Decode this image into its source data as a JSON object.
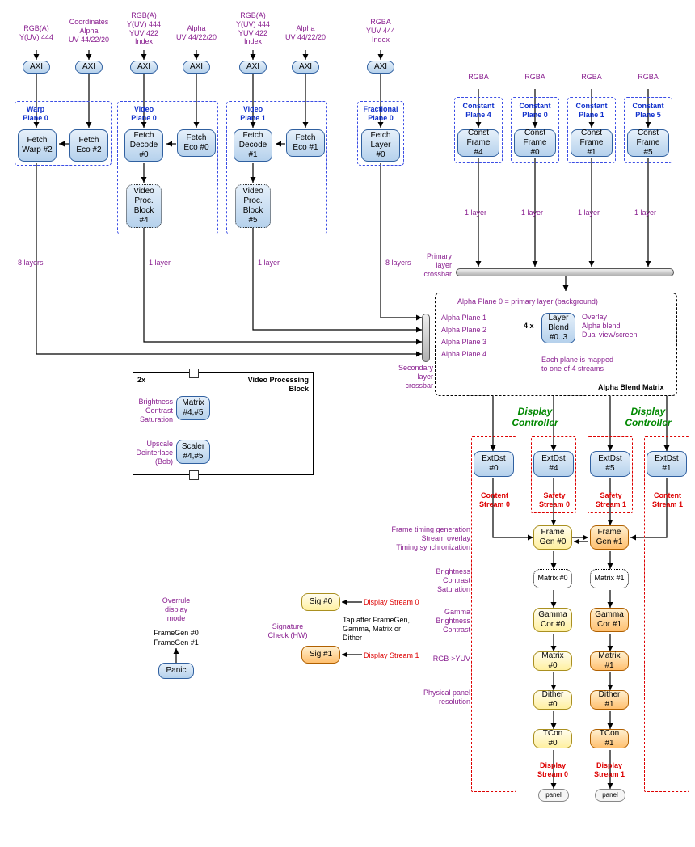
{
  "headers": {
    "col1": "RGB(A)\nY(UV) 444",
    "col2": "Coordinates\nAlpha\nUV 44/22/20",
    "col3": "RGB(A)\nY(UV) 444\nYUV 422\nIndex",
    "col4": "Alpha\nUV 44/22/20",
    "col5": "RGB(A)\nY(UV) 444\nYUV 422\nIndex",
    "col6": "Alpha\nUV 44/22/20",
    "col7": "RGBA\nYUV 444\nIndex",
    "c0": "RGBA",
    "c1": "RGBA",
    "c2": "RGBA",
    "c3": "RGBA"
  },
  "axi": "AXI",
  "planes": {
    "warp0": "Warp\nPlane 0",
    "video0": "Video\nPlane 0",
    "video1": "Video\nPlane 1",
    "frac0": "Fractional\nPlane 0",
    "const4": "Constant\nPlane 4",
    "const0": "Constant\nPlane 0",
    "const1": "Constant\nPlane 1",
    "const5": "Constant\nPlane 5"
  },
  "blocks": {
    "fetchWarp2": "Fetch\nWarp #2",
    "fetchEco2": "Fetch\nEco #2",
    "fetchDec0": "Fetch\nDecode\n#0",
    "fetchEco0": "Fetch\nEco #0",
    "fetchDec1": "Fetch\nDecode\n#1",
    "fetchEco1": "Fetch\nEco #1",
    "fetchLayer0": "Fetch\nLayer #0",
    "vpb4": "Video\nProc.\nBlock\n#4",
    "vpb5": "Video\nProc.\nBlock\n#5",
    "constF4": "Const\nFrame #4",
    "constF0": "Const\nFrame #0",
    "constF1": "Const\nFrame #1",
    "constF5": "Const\nFrame #5",
    "matrix45": "Matrix\n#4,#5",
    "scaler45": "Scaler\n#4,#5",
    "layerBlend": "Layer\nBlend\n#0..3",
    "extDst0": "ExtDst\n#0",
    "extDst4": "ExtDst\n#4",
    "extDst5": "ExtDst\n#5",
    "extDst1": "ExtDst\n#1",
    "frameGen0": "Frame\nGen #0",
    "frameGen1": "Frame\nGen #1",
    "matrix0": "Matrix #0",
    "matrix1": "Matrix #1",
    "gamma0": "Gamma\nCor #0",
    "gamma1": "Gamma\nCor #1",
    "matrix0b": "Matrix #0",
    "matrix1b": "Matrix #1",
    "dither0": "Dither #0",
    "dither1": "Dither #1",
    "tcon0": "TCon #0",
    "tcon1": "TCon #1",
    "panel": "panel",
    "sig0": "Sig #0",
    "sig1": "Sig #1",
    "panic": "Panic"
  },
  "labels": {
    "eightLayers": "8 layers",
    "oneLayer": "1 layer",
    "primaryCrossbar": "Primary\nlayer\ncrossbar",
    "secondaryCrossbar": "Secondary\nlayer\ncrossbar",
    "alphaBg": "Alpha Plane 0 = primary layer (background)",
    "alpha1": "Alpha Plane 1",
    "alpha2": "Alpha Plane 2",
    "alpha3": "Alpha Plane 3",
    "alpha4": "Alpha Plane 4",
    "fourX": "4 x",
    "overlay": "Overlay\nAlpha blend\nDual view/screen",
    "mapped": "Each plane is mapped\nto one of 4 streams",
    "alphaBlendMatrix": "Alpha Blend Matrix",
    "dispController": "Display\nController",
    "contentStream0": "Content\nStream 0",
    "safetyStream0": "Safety\nStream 0",
    "safetyStream1": "Safety\nStream 1",
    "contentStream1": "Content\nStream 1",
    "frameTiming": "Frame timing generation\nStream overlay\nTiming synchronization",
    "bcs": "Brightness\nContrast\nSaturation",
    "gbc": "Gamma\nBrightness\nContrast",
    "rgbyuv": "RGB->YUV",
    "phys": "Physical panel\nresolution",
    "displayStream0": "Display\nStream 0",
    "displayStream1": "Display\nStream 1",
    "ds0": "Display Stream 0",
    "ds1": "Display Stream 1",
    "sigCheck": "Signature\nCheck (HW)",
    "tapAfter": "Tap after FrameGen,\nGamma, Matrix  or\nDither",
    "overrule": "Overrule\ndisplay\nmode",
    "fg0": "FrameGen #0",
    "fg1": "FrameGen #1",
    "twoX": "2x",
    "vpbTitle": "Video Processing\nBlock",
    "upscale": "Upscale\nDeinterlace\n(Bob)"
  }
}
